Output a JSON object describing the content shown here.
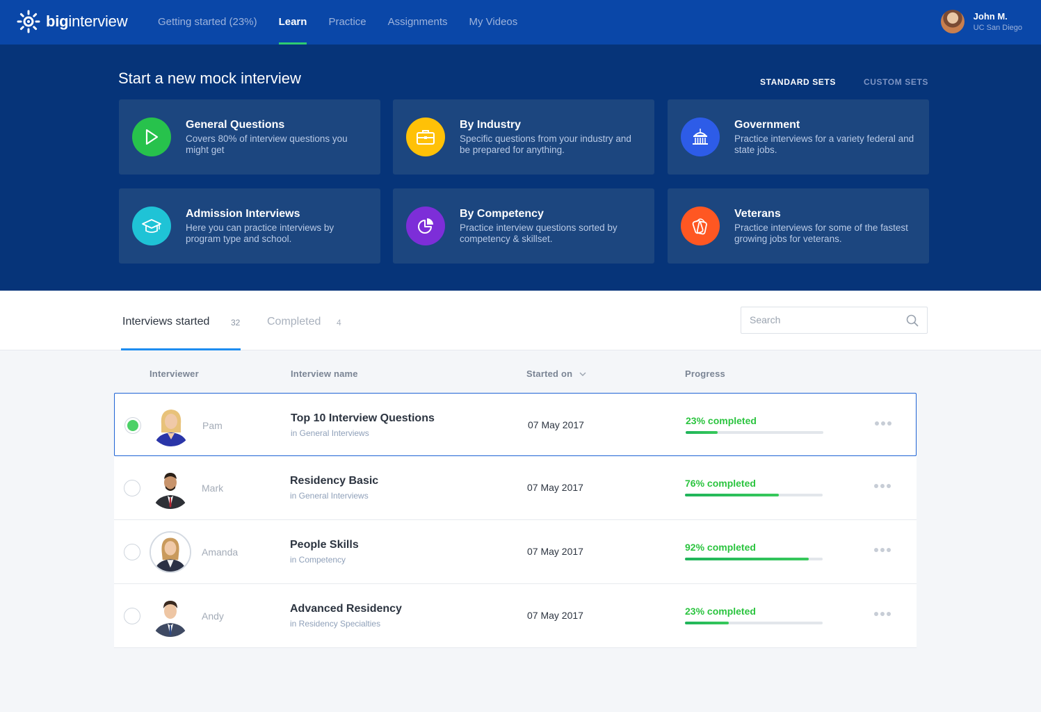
{
  "brand": {
    "bold": "big",
    "light": "interview"
  },
  "nav": [
    {
      "label": "Getting started (23%)",
      "active": false
    },
    {
      "label": "Learn",
      "active": true
    },
    {
      "label": "Practice",
      "active": false
    },
    {
      "label": "Assignments",
      "active": false
    },
    {
      "label": "My Videos",
      "active": false
    }
  ],
  "user": {
    "name": "John M.",
    "org": "UC San Diego"
  },
  "hero": {
    "title": "Start a new mock interview",
    "sets": [
      {
        "label": "STANDARD SETS",
        "active": true
      },
      {
        "label": "CUSTOM SETS",
        "active": false
      }
    ],
    "cards": [
      {
        "title": "General Questions",
        "desc": "Covers 80% of interview questions you might get",
        "icon": "play-icon",
        "color": "#27c24c"
      },
      {
        "title": "By Industry",
        "desc": "Specific questions from your industry and be prepared for anything.",
        "icon": "briefcase-icon",
        "color": "#ffc107"
      },
      {
        "title": "Government",
        "desc": "Practice interviews for a variety federal and state jobs.",
        "icon": "capitol-icon",
        "color": "#2d5ce8"
      },
      {
        "title": "Admission Interviews",
        "desc": "Here you can practice interviews by program type and school.",
        "icon": "graduation-cap-icon",
        "color": "#1fc3d6"
      },
      {
        "title": "By Competency",
        "desc": "Practice interview questions sorted by competency & skillset.",
        "icon": "pie-chart-icon",
        "color": "#7d2ed8"
      },
      {
        "title": "Veterans",
        "desc": "Practice interviews for some of the fastest growing jobs for veterans.",
        "icon": "dog-tags-icon",
        "color": "#ff5722"
      }
    ]
  },
  "tabs": [
    {
      "label": "Interviews started",
      "count": "32",
      "active": true
    },
    {
      "label": "Completed",
      "count": "4",
      "active": false
    }
  ],
  "search": {
    "placeholder": "Search"
  },
  "table": {
    "headers": {
      "interviewer": "Interviewer",
      "name": "Interview name",
      "started": "Started on",
      "progress": "Progress"
    },
    "rows": [
      {
        "interviewer": "Pam",
        "name": "Top 10 Interview Questions",
        "category": "in General Interviews",
        "date": "07 May 2017",
        "progress_label": "23% completed",
        "progress": 0.23,
        "selected": true
      },
      {
        "interviewer": "Mark",
        "name": "Residency Basic",
        "category": "in General Interviews",
        "date": "07 May 2017",
        "progress_label": "76% completed",
        "progress": 0.68,
        "selected": false
      },
      {
        "interviewer": "Amanda",
        "name": "People Skills",
        "category": "in Competency",
        "date": "07 May 2017",
        "progress_label": "92% completed",
        "progress": 0.9,
        "selected": false
      },
      {
        "interviewer": "Andy",
        "name": "Advanced Residency",
        "category": "in Residency Specialties",
        "date": "07 May 2017",
        "progress_label": "23% completed",
        "progress": 0.32,
        "selected": false
      }
    ]
  }
}
